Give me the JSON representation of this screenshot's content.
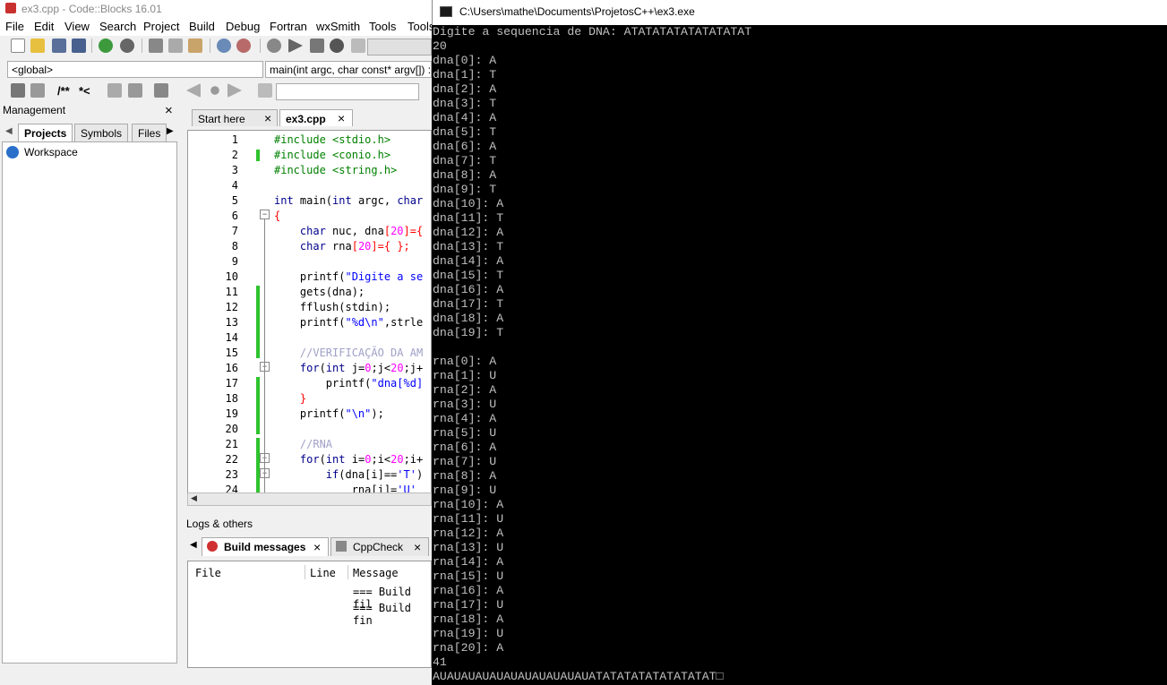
{
  "ide": {
    "title": "ex3.cpp - Code::Blocks 16.01",
    "menu": [
      "File",
      "Edit",
      "View",
      "Search",
      "Project",
      "Build",
      "Debug",
      "Fortran",
      "wxSmith",
      "Tools",
      "Tools+"
    ],
    "scope_combo": "<global>",
    "function_combo": "main(int argc, char const* argv[]) : int",
    "management": {
      "title": "Management",
      "tabs": [
        "Projects",
        "Symbols",
        "Files"
      ],
      "tree_root": "Workspace"
    },
    "editor_tabs": [
      "Start here",
      "ex3.cpp"
    ],
    "line_numbers": [
      "1",
      "2",
      "3",
      "4",
      "5",
      "6",
      "7",
      "8",
      "9",
      "10",
      "11",
      "12",
      "13",
      "14",
      "15",
      "16",
      "17",
      "18",
      "19",
      "20",
      "21",
      "22",
      "23",
      "24"
    ],
    "logs": {
      "title": "Logs & others",
      "tabs": [
        "Build messages",
        "CppCheck"
      ],
      "columns": [
        "File",
        "Line",
        "Message"
      ],
      "messages": [
        "=== Build fil",
        "=== Build fin"
      ]
    }
  },
  "console": {
    "title": "C:\\Users\\mathe\\Documents\\ProjetosC++\\ex3.exe",
    "lines": [
      "Digite a sequencia de DNA: ATATATATATATATATAT",
      "20",
      "dna[0]: A",
      "dna[1]: T",
      "dna[2]: A",
      "dna[3]: T",
      "dna[4]: A",
      "dna[5]: T",
      "dna[6]: A",
      "dna[7]: T",
      "dna[8]: A",
      "dna[9]: T",
      "dna[10]: A",
      "dna[11]: T",
      "dna[12]: A",
      "dna[13]: T",
      "dna[14]: A",
      "dna[15]: T",
      "dna[16]: A",
      "dna[17]: T",
      "dna[18]: A",
      "dna[19]: T",
      "",
      "rna[0]: A",
      "rna[1]: U",
      "rna[2]: A",
      "rna[3]: U",
      "rna[4]: A",
      "rna[5]: U",
      "rna[6]: A",
      "rna[7]: U",
      "rna[8]: A",
      "rna[9]: U",
      "rna[10]: A",
      "rna[11]: U",
      "rna[12]: A",
      "rna[13]: U",
      "rna[14]: A",
      "rna[15]: U",
      "rna[16]: A",
      "rna[17]: U",
      "rna[18]: A",
      "rna[19]: U",
      "rna[20]: A",
      "41",
      "AUAUAUAUAUAUAUAUAUAUAUATATATATATATATATAT□"
    ]
  }
}
